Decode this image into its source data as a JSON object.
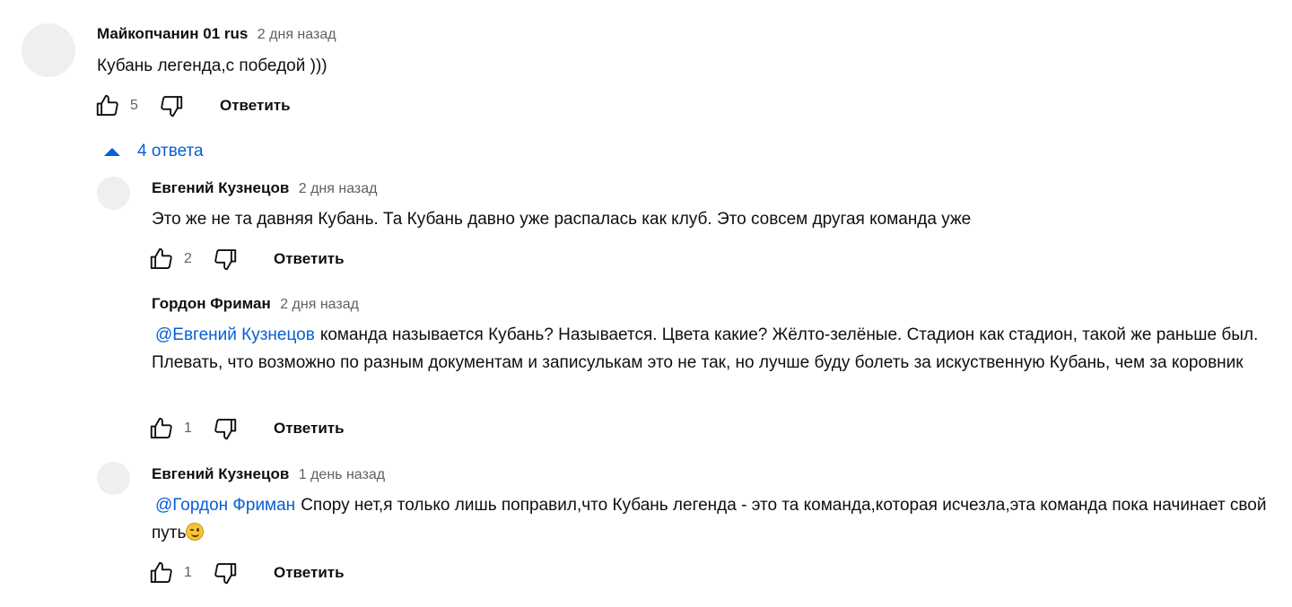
{
  "thread": {
    "top_comment": {
      "author": "Майкопчанин 01 rus",
      "time": "2 дня назад",
      "text": "Кубань легенда,с победой )))",
      "likes": "5",
      "reply_label": "Ответить"
    },
    "replies_toggle": {
      "label": "4 ответа",
      "icon": "caret-up-icon",
      "color": "#065fd4"
    },
    "replies": [
      {
        "author": "Евгений Кузнецов",
        "time": "2 дня назад",
        "mention": "",
        "text": "Это же не та давняя Кубань. Та Кубань давно уже распалась как клуб. Это совсем другая команда уже",
        "likes": "2",
        "reply_label": "Ответить"
      },
      {
        "author": "Гордон Фриман",
        "time": "2 дня назад",
        "mention": "@Евгений Кузнецов",
        "text": "команда называется Кубань? Называется. Цвета какие? Жёлто-зелёные. Стадион как стадион, такой же раньше был. Плевать, что возможно по разным документам и записулькам это не так, но лучше буду болеть за искуственную Кубань, чем за коровник",
        "likes": "1",
        "reply_label": "Ответить"
      },
      {
        "author": "Евгений Кузнецов",
        "time": "1 день назад",
        "mention": "@Гордон Фриман",
        "text": "Спору нет,я только лишь поправил,что Кубань легенда - это та команда,которая исчезла,эта команда пока начинает свой путь",
        "emoji": "winking-face-emoji",
        "likes": "1",
        "reply_label": "Ответить"
      }
    ]
  },
  "icons": {
    "like": "thumbs-up-icon",
    "dislike": "thumbs-down-icon"
  },
  "colors": {
    "text": "#0f0f0f",
    "secondary": "#606060",
    "link": "#065fd4",
    "avatar_placeholder": "#efefef"
  }
}
